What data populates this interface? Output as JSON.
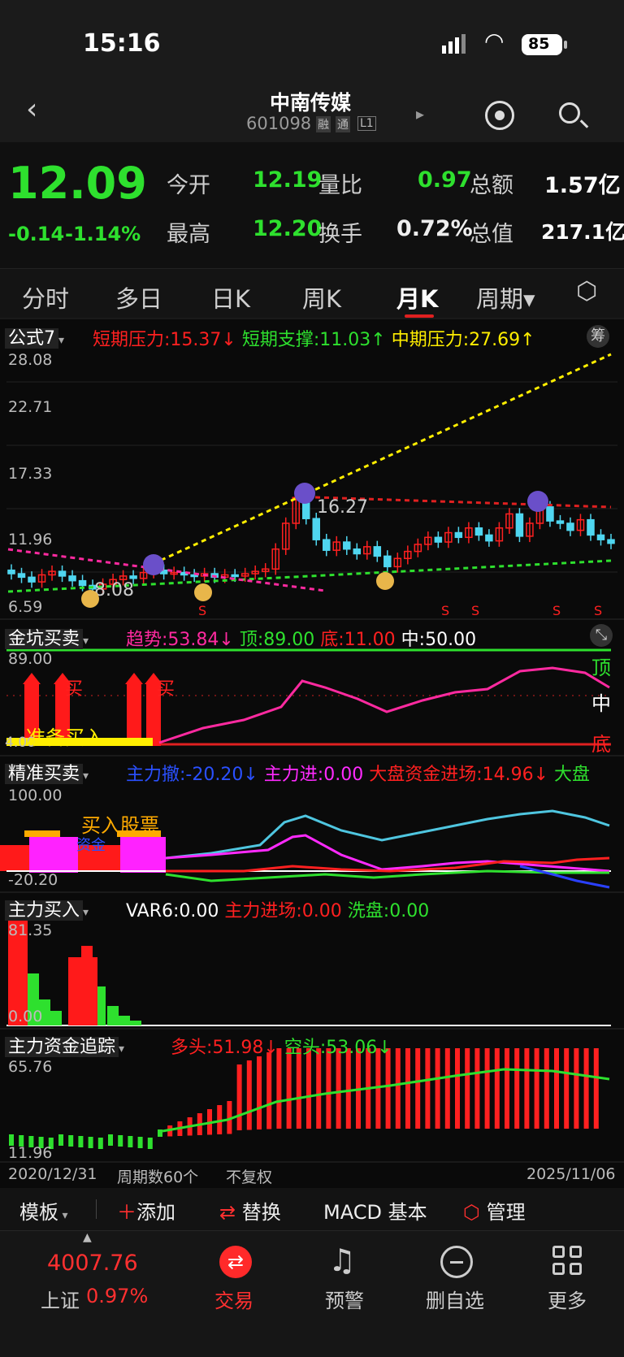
{
  "status_bar": {
    "time": "15:16",
    "battery": "85"
  },
  "header": {
    "title": "中南传媒",
    "code": "601098",
    "tags": [
      "融",
      "通",
      "L1"
    ]
  },
  "quote": {
    "price": "12.09",
    "change": "-0.14",
    "change_pct": "-1.14%",
    "open_label": "今开",
    "open": "12.19",
    "high_label": "最高",
    "high": "12.20",
    "volratio_label": "量比",
    "volratio": "0.97",
    "turnover_label": "换手",
    "turnover": "0.72%",
    "amount_label": "总额",
    "amount": "1.57亿",
    "mktcap_label": "总值",
    "mktcap": "217.1亿"
  },
  "tabs": [
    "分时",
    "多日",
    "日K",
    "周K",
    "月K",
    "周期▾"
  ],
  "main_panel": {
    "name": "公式7",
    "short_pressure_label": "短期压力:",
    "short_pressure": "15.37↓",
    "short_support_label": "短期支撑:",
    "short_support": "11.03↑",
    "mid_pressure_label": "中期压力:",
    "mid_pressure": "27.69↑",
    "chip_label": "筹",
    "y_ticks": [
      "28.08",
      "22.71",
      "17.33",
      "11.96",
      "6.59"
    ],
    "peak_label": "16.27",
    "low_label": "8.08",
    "s_marker": "S"
  },
  "panel2": {
    "name": "金坑买卖",
    "trend_label": "趋势:",
    "trend": "53.84↓",
    "top_label": "顶:",
    "top": "89.00",
    "bottom_label": "底:",
    "bottom": "11.00",
    "mid_label": "中:",
    "mid": "50.00",
    "y_top": "89.00",
    "y_bottom": "4.00",
    "right_top": "顶",
    "right_mid": "中",
    "right_bottom": "底",
    "buy": "买",
    "prepare_buy": "准备买入"
  },
  "panel3": {
    "name": "精准买卖",
    "main_out_label": "主力撤:",
    "main_out": "-20.20↓",
    "main_in_label": "主力进:",
    "main_in": "0.00",
    "market_fund_label": "大盘资金进场:",
    "market_fund": "14.96↓",
    "more": "大盘",
    "y_top": "100.00",
    "y_bottom": "-20.20",
    "buy_stock": "买入股票",
    "fund_label": "资金"
  },
  "panel4": {
    "name": "主力买入",
    "var6_label": "VAR6:",
    "var6": "0.00",
    "main_entry_label": "主力进场:",
    "main_entry": "0.00",
    "wash_label": "洗盘:",
    "wash": "0.00",
    "y_top": "81.35",
    "y_bottom": "0.00"
  },
  "panel5": {
    "name": "主力资金追踪",
    "long_label": "多头:",
    "long": "51.98↓",
    "short_label": "空头:",
    "short": "53.06↓",
    "y_top": "65.76",
    "y_bottom": "11.96"
  },
  "footer_axis": {
    "start": "2020/12/31",
    "periods": "周期数60个",
    "adjust": "不复权",
    "end": "2025/11/06"
  },
  "toolbar": {
    "template": "模板",
    "add": "添加",
    "replace": "替换",
    "macd": "MACD 基本",
    "manage": "管理"
  },
  "bottom_nav": {
    "index_value": "4007.76",
    "index_name": "上证",
    "index_pct": "0.97%",
    "trade": "交易",
    "alert": "预警",
    "remove": "删自选",
    "more": "更多"
  },
  "colors": {
    "up": "#ff2020",
    "down": "#2ee02e",
    "yellow": "#ffee00",
    "magenta": "#ff2aa0",
    "cyan": "#4fd6f0"
  }
}
